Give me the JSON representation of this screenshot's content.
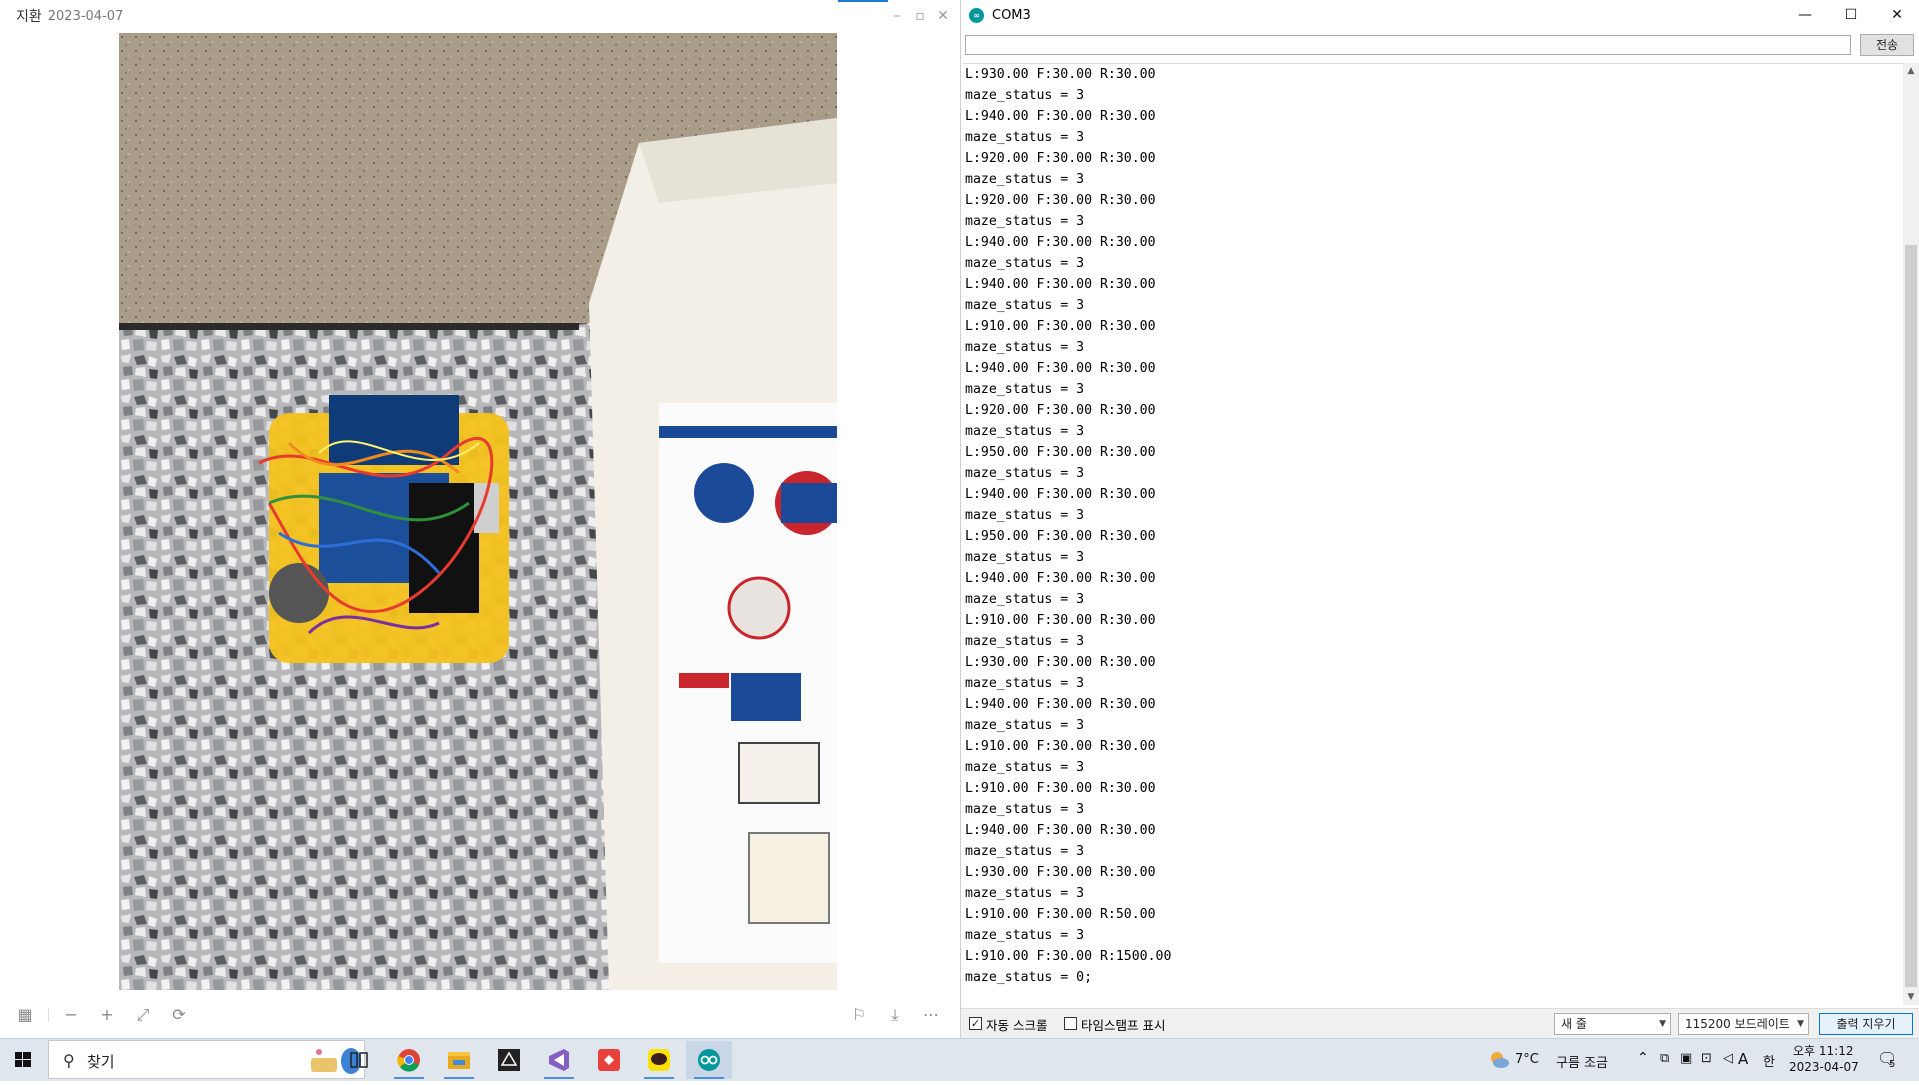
{
  "viewer": {
    "title": "지환",
    "date": "2023-04-07",
    "controls": [
      "minimize",
      "maximize",
      "close"
    ]
  },
  "serial": {
    "title": "COM3",
    "send_input_value": "",
    "send_button": "전송",
    "output_lines": [
      "L:930.00 F:30.00 R:30.00",
      "maze_status = 3",
      "L:940.00 F:30.00 R:30.00",
      "maze_status = 3",
      "L:920.00 F:30.00 R:30.00",
      "maze_status = 3",
      "L:920.00 F:30.00 R:30.00",
      "maze_status = 3",
      "L:940.00 F:30.00 R:30.00",
      "maze_status = 3",
      "L:940.00 F:30.00 R:30.00",
      "maze_status = 3",
      "L:910.00 F:30.00 R:30.00",
      "maze_status = 3",
      "L:940.00 F:30.00 R:30.00",
      "maze_status = 3",
      "L:920.00 F:30.00 R:30.00",
      "maze_status = 3",
      "L:950.00 F:30.00 R:30.00",
      "maze_status = 3",
      "L:940.00 F:30.00 R:30.00",
      "maze_status = 3",
      "L:950.00 F:30.00 R:30.00",
      "maze_status = 3",
      "L:940.00 F:30.00 R:30.00",
      "maze_status = 3",
      "L:910.00 F:30.00 R:30.00",
      "maze_status = 3",
      "L:930.00 F:30.00 R:30.00",
      "maze_status = 3",
      "L:940.00 F:30.00 R:30.00",
      "maze_status = 3",
      "L:910.00 F:30.00 R:30.00",
      "maze_status = 3",
      "L:910.00 F:30.00 R:30.00",
      "maze_status = 3",
      "L:940.00 F:30.00 R:30.00",
      "maze_status = 3",
      "L:930.00 F:30.00 R:30.00",
      "maze_status = 3",
      "L:910.00 F:30.00 R:50.00",
      "maze_status = 3",
      "L:910.00 F:30.00 R:1500.00",
      "maze_status = 0;"
    ],
    "autoscroll_label": "자동 스크롤",
    "autoscroll_checked": true,
    "timestamp_label": "타임스탬프 표시",
    "timestamp_checked": false,
    "line_ending": "새 줄",
    "baud_rate": "115200 보드레이트",
    "clear_button": "출력 지우기"
  },
  "taskbar": {
    "search_placeholder": "찾기",
    "apps": [
      "task-view",
      "chrome",
      "file-explorer",
      "unity",
      "visual-studio",
      "git-app",
      "kakaotalk",
      "arduino"
    ],
    "weather_temp": "7°C",
    "weather_desc": "구름 조금",
    "ime_lang": "A",
    "ime_korean": "한",
    "time": "오후 11:12",
    "date": "2023-04-07",
    "notification_count": "5"
  },
  "colors": {
    "arduino_teal": "#00979c",
    "accent_blue": "#0078d7",
    "taskbar_bg": "#dfe6ee"
  }
}
